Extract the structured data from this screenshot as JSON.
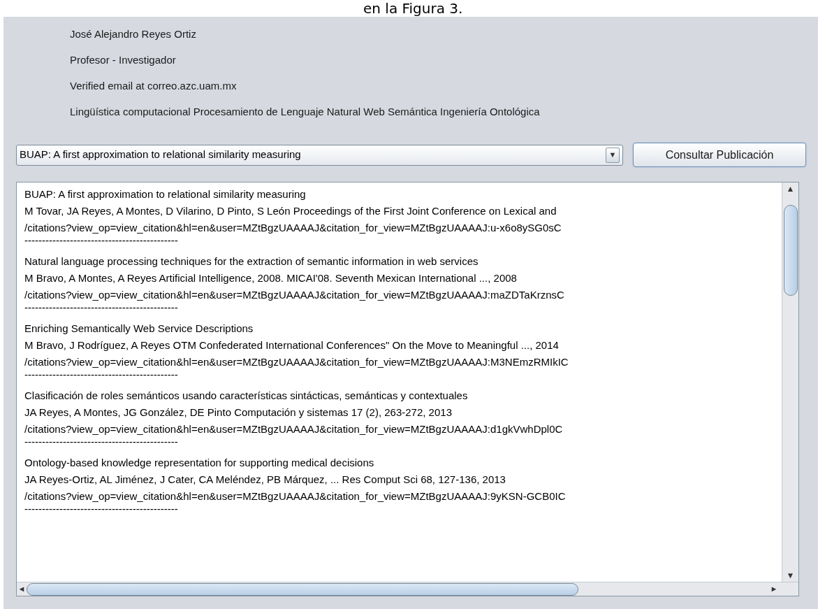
{
  "caption": "en la Figura 3.",
  "profile": {
    "name": "José Alejandro Reyes Ortiz",
    "position": "Profesor - Investigador",
    "email": "Verified email at correo.azc.uam.mx",
    "interests": "Lingüística computacional Procesamiento de Lenguaje Natural Web Semántica Ingeniería Ontológica"
  },
  "publication_select": {
    "value": "BUAP: A first approximation to relational similarity measuring",
    "arrow": "▼"
  },
  "consult_button": "Consultar Publicación",
  "results": [
    {
      "title": "BUAP: A first approximation to relational similarity measuring",
      "authors": "M Tovar, JA Reyes, A Montes, D Vilarino, D Pinto, S León Proceedings of the First Joint Conference on Lexical and",
      "link": "/citations?view_op=view_citation&hl=en&user=MZtBgzUAAAAJ&citation_for_view=MZtBgzUAAAAJ:u-x6o8ySG0sC",
      "separator": "--------------------------------------------"
    },
    {
      "title": "Natural language processing techniques for the extraction of semantic information in web services",
      "authors": "M Bravo, A Montes, A Reyes Artificial Intelligence, 2008. MICAI'08. Seventh Mexican International ..., 2008",
      "link": "/citations?view_op=view_citation&hl=en&user=MZtBgzUAAAAJ&citation_for_view=MZtBgzUAAAAJ:maZDTaKrznsC",
      "separator": "--------------------------------------------"
    },
    {
      "title": "Enriching Semantically Web Service Descriptions",
      "authors": "M Bravo, J Rodríguez, A Reyes OTM Confederated International Conferences\" On the Move to Meaningful ..., 2014",
      "link": "/citations?view_op=view_citation&hl=en&user=MZtBgzUAAAAJ&citation_for_view=MZtBgzUAAAAJ:M3NEmzRMIkIC",
      "separator": "--------------------------------------------"
    },
    {
      "title": "Clasificación de roles semánticos usando características sintácticas, semánticas y contextuales",
      "authors": "JA Reyes, A Montes, JG González, DE Pinto Computación y sistemas 17 (2), 263-272, 2013",
      "link": "/citations?view_op=view_citation&hl=en&user=MZtBgzUAAAAJ&citation_for_view=MZtBgzUAAAAJ:d1gkVwhDpl0C",
      "separator": "--------------------------------------------"
    },
    {
      "title": "Ontology-based knowledge representation for supporting medical decisions",
      "authors": "JA Reyes-Ortiz, AL Jiménez, J Cater, CA Meléndez, PB Márquez, ... Res Comput Sci 68, 127-136, 2013",
      "link": "/citations?view_op=view_citation&hl=en&user=MZtBgzUAAAAJ&citation_for_view=MZtBgzUAAAAJ:9yKSN-GCB0IC",
      "separator": "--------------------------------------------"
    }
  ],
  "scroll_arrows": {
    "up": "▲",
    "down": "▼",
    "left": "◄",
    "right": "►"
  }
}
